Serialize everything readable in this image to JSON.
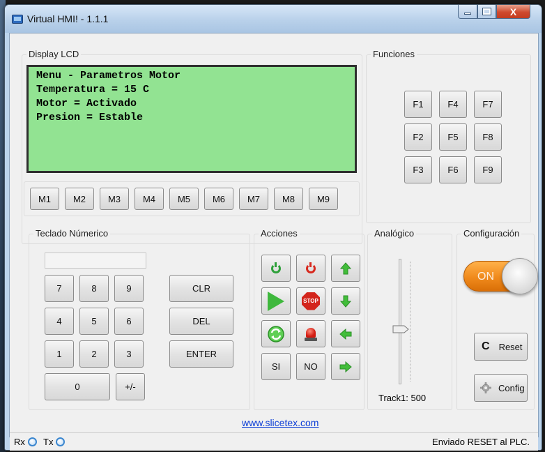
{
  "window": {
    "title": "Virtual HMI! - 1.1.1",
    "close_glyph": "X"
  },
  "display": {
    "title": "Display LCD",
    "lines": [
      "Menu - Parametros Motor",
      "Temperatura = 15 C",
      "Motor = Activado",
      "Presion = Estable"
    ]
  },
  "m_buttons": [
    "M1",
    "M2",
    "M3",
    "M4",
    "M5",
    "M6",
    "M7",
    "M8",
    "M9"
  ],
  "funciones": {
    "title": "Funciones",
    "buttons": [
      "F1",
      "F4",
      "F7",
      "F2",
      "F5",
      "F8",
      "F3",
      "F6",
      "F9"
    ]
  },
  "teclado": {
    "title": "Teclado Númerico",
    "display_value": "",
    "keys": [
      "7",
      "8",
      "9",
      "4",
      "5",
      "6",
      "1",
      "2",
      "3"
    ],
    "zero": "0",
    "sign": "+/-",
    "clr": "CLR",
    "del": "DEL",
    "enter": "ENTER"
  },
  "acciones": {
    "title": "Acciones",
    "stop_text": "STOP",
    "si": "SI",
    "no": "NO"
  },
  "analogico": {
    "title": "Analógico",
    "track_label": "Track1: 500",
    "slider_fraction": 0.43
  },
  "config": {
    "title": "Configuración",
    "toggle_text": "ON",
    "reset": "Reset",
    "config_label": "Config",
    "reset_glyph": "C"
  },
  "link": "www.slicetex.com",
  "status": {
    "rx": "Rx",
    "tx": "Tx",
    "message": "Enviado RESET al PLC."
  },
  "colors": {
    "lcd": "#92e392",
    "toggle_on": "#f08a1c",
    "accent_green": "#3fb83d",
    "accent_red": "#d3251c"
  }
}
